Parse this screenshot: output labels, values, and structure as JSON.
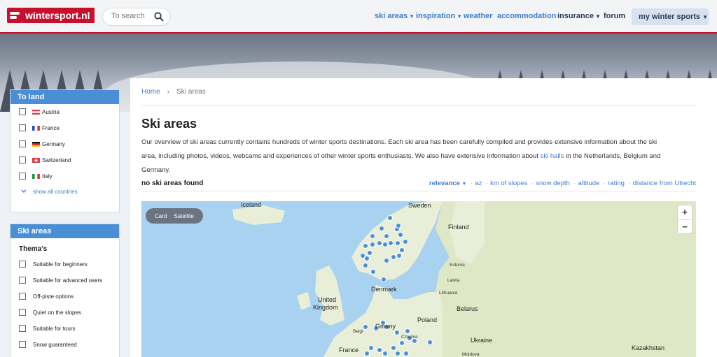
{
  "header": {
    "logo_text": "wintersport.nl",
    "search_placeholder": "To search",
    "nav": {
      "ski_areas": "ski areas",
      "inspiration": "inspiration",
      "weather": "weather",
      "accommodation": "accommodation",
      "insurance": "insurance",
      "forum": "forum",
      "my_winter_sports": "my winter sports"
    }
  },
  "sidebar": {
    "countries": {
      "title": "To land",
      "items": [
        "Austria",
        "France",
        "Germany",
        "Switzerland",
        "Italy"
      ],
      "show_all": "show all countries"
    },
    "ski_areas": {
      "title": "Ski areas",
      "themes_label": "Thema's",
      "items": [
        "Suitable for beginners",
        "Suitable for advanced users",
        "Off-piste options",
        "Quiet on the slopes",
        "Suitable for tours",
        "Snow guaranteed"
      ]
    }
  },
  "main": {
    "breadcrumb": {
      "home": "Home",
      "current": "Ski areas"
    },
    "title": "Ski areas",
    "intro_before": "Our overview of ski areas currently contains hundreds of winter sports destinations. Each ski area has been carefully compiled and provides extensive information about the ski area, including photos, videos, webcams and experiences of other winter sports enthusiasts. We also have extensive information about ",
    "intro_link": "ski halls",
    "intro_after": " in the Netherlands, Belgium and Germany.",
    "results_text": "no ski areas found",
    "sort": {
      "active": "relevance",
      "options": [
        "az",
        "km of slopes",
        "snow depth",
        "altitude",
        "rating",
        "distance from Utrecht"
      ]
    }
  },
  "map": {
    "toggle": [
      "Card",
      "Satellite"
    ],
    "zoom_in": "+",
    "zoom_out": "−",
    "labels": {
      "iceland": "Iceland",
      "sweden": "Sweden",
      "finland": "Finland",
      "estonia": "Estonia",
      "latvia": "Latvia",
      "lithuania": "Lithuania",
      "denmark": "Denmark",
      "united_kingdom_1": "United",
      "united_kingdom_2": "Kingdom",
      "belarus": "Belarus",
      "poland": "Poland",
      "belgium": "Belgi",
      "germany": "Gmany",
      "czechia": "Czechia",
      "ukraine": "Ukraine",
      "france": "France",
      "moldova": "Moldova",
      "kazakhstan": "Kazakhstan"
    },
    "colors": {
      "water": "#a8d2f0",
      "land": "#e9eed8",
      "land_green": "#dfe8c6",
      "marker": "#4a90d9"
    }
  }
}
